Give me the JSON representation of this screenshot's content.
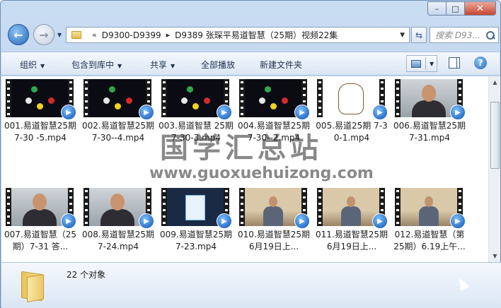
{
  "window": {
    "controls": {
      "minimize": "–",
      "maximize": "□",
      "close": "✕"
    }
  },
  "nav": {
    "back_icon": "arrow-left-icon",
    "forward_icon": "arrow-right-icon",
    "breadcrumb_overflow": "«",
    "breadcrumbs": [
      "D9300-D9399",
      "D9389 张琛平易道智慧（25期）视频22集"
    ],
    "breadcrumb_separator": "▸",
    "search_placeholder": "搜索 D93..."
  },
  "toolbar": {
    "organize": "组织",
    "include_in_library": "包含到库中",
    "share": "共享",
    "play_all": "全部播放",
    "new_folder": "新建文件夹"
  },
  "files": [
    {
      "name": "001.易道智慧25期 7-30 -5.mp4",
      "thumb": "board"
    },
    {
      "name": "002.易道智慧25期 7-30--4.mp4",
      "thumb": "board"
    },
    {
      "name": "003.易道智慧 25期 7-30-3.mp4",
      "thumb": "board"
    },
    {
      "name": "004.易道智慧25期 7-30--2.mp4",
      "thumb": "board"
    },
    {
      "name": "005.易道25期 7-30-1.mp4",
      "thumb": "hand"
    },
    {
      "name": "006.易道智慧25期7-31.mp4",
      "thumb": "person"
    },
    {
      "name": "007.易道智慧（25期）7-31 答...",
      "thumb": "person"
    },
    {
      "name": "008.易道智慧25期7-24.mp4",
      "thumb": "person"
    },
    {
      "name": "009.易道智慧25期7-23.mp4",
      "thumb": "hex"
    },
    {
      "name": "010.易道智慧25期6月19日上...",
      "thumb": "studio"
    },
    {
      "name": "011.易道智慧25期6月19日上...",
      "thumb": "studio"
    },
    {
      "name": "012.易道智慧（第25期）6.19上午...",
      "thumb": "studio"
    }
  ],
  "watermark": {
    "title": "国学汇总站",
    "url": "www.guoxuehuizong.com"
  },
  "details": {
    "count": "22 个对象"
  },
  "colors": {
    "accent": "#2366b7",
    "frame": "#b4cde9",
    "wmp_badge": "#0a4fb0"
  }
}
